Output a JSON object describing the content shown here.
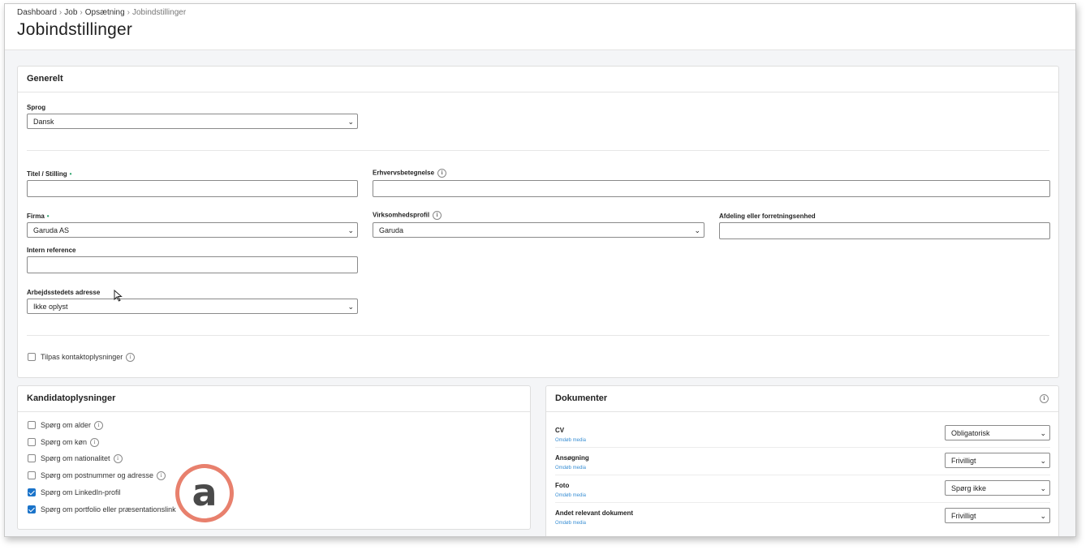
{
  "breadcrumb": [
    "Dashboard",
    "Job",
    "Opsætning",
    "Jobindstillinger"
  ],
  "page_title": "Jobindstillinger",
  "general": {
    "heading": "Generelt",
    "language": {
      "label": "Sprog",
      "value": "Dansk"
    },
    "title": {
      "label": "Titel / Stilling",
      "required_mark": "•",
      "value": ""
    },
    "occupation": {
      "label": "Erhvervsbetegnelse",
      "value": ""
    },
    "company": {
      "label": "Firma",
      "required_mark": "•",
      "value": "Garuda AS"
    },
    "business_profile": {
      "label": "Virksomhedsprofil",
      "value": "Garuda"
    },
    "department": {
      "label": "Afdeling eller forretningsenhed",
      "value": ""
    },
    "internal_ref": {
      "label": "Intern reference",
      "value": ""
    },
    "workplace_address": {
      "label": "Arbejdsstedets adresse",
      "value": "Ikke oplyst"
    },
    "customize_contact": {
      "label": "Tilpas kontaktoplysninger",
      "checked": false
    }
  },
  "candidate": {
    "heading": "Kandidatoplysninger",
    "items": [
      {
        "label": "Spørg om alder",
        "checked": false,
        "info": true
      },
      {
        "label": "Spørg om køn",
        "checked": false,
        "info": true
      },
      {
        "label": "Spørg om nationalitet",
        "checked": false,
        "info": true
      },
      {
        "label": "Spørg om postnummer og adresse",
        "checked": false,
        "info": true
      },
      {
        "label": "Spørg om LinkedIn-profil",
        "checked": true,
        "info": false
      },
      {
        "label": "Spørg om portfolio eller præsentationslink",
        "checked": true,
        "info": false
      }
    ]
  },
  "documents": {
    "heading": "Dokumenter",
    "rename_label": "Omdøb media",
    "items": [
      {
        "name": "CV",
        "value": "Obligatorisk"
      },
      {
        "name": "Ansøgning",
        "value": "Frivilligt"
      },
      {
        "name": "Foto",
        "value": "Spørg ikke"
      },
      {
        "name": "Andet relevant dokument",
        "value": "Frivilligt"
      }
    ]
  },
  "annotation_badge": "a",
  "colors": {
    "accent": "#1a73c9",
    "required": "#2aa36b",
    "badge_ring": "#e8806d",
    "link": "#3a8fd4"
  }
}
